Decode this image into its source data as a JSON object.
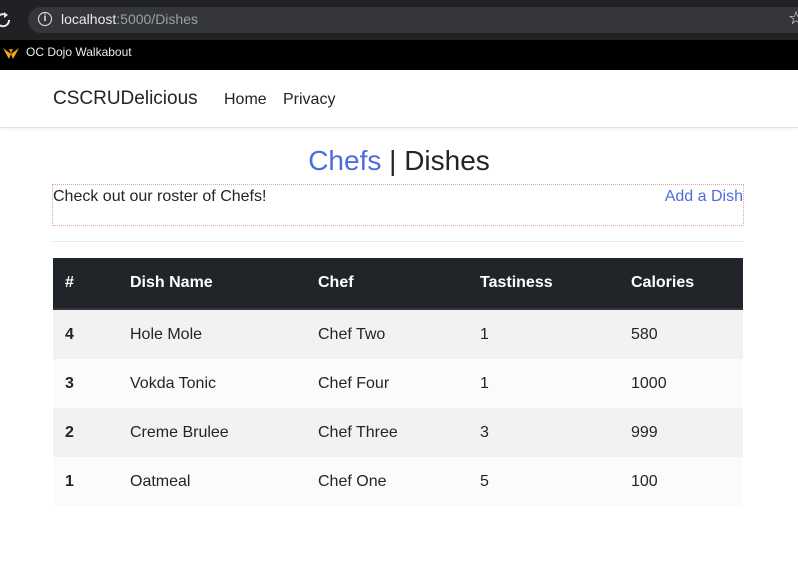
{
  "browser": {
    "url_host": "localhost",
    "url_path": ":5000/Dishes",
    "bookmark": "OC Dojo Walkabout"
  },
  "navbar": {
    "brand": "CSCRUDelicious",
    "links": [
      "Home",
      "Privacy"
    ]
  },
  "heading": {
    "chefs_link": "Chefs",
    "separator": " | ",
    "current": "Dishes"
  },
  "subheader": {
    "text": "Check out our roster of Chefs!",
    "add_link": "Add a Dish"
  },
  "table": {
    "headers": [
      "#",
      "Dish Name",
      "Chef",
      "Tastiness",
      "Calories"
    ],
    "rows": [
      [
        "4",
        "Hole Mole",
        "Chef Two",
        "1",
        "580"
      ],
      [
        "3",
        "Vokda Tonic",
        "Chef Four",
        "1",
        "1000"
      ],
      [
        "2",
        "Creme Brulee",
        "Chef Three",
        "3",
        "999"
      ],
      [
        "1",
        "Oatmeal",
        "Chef One",
        "5",
        "100"
      ]
    ]
  },
  "colors": {
    "link": "#4f6bdc",
    "table_header": "#212529"
  }
}
